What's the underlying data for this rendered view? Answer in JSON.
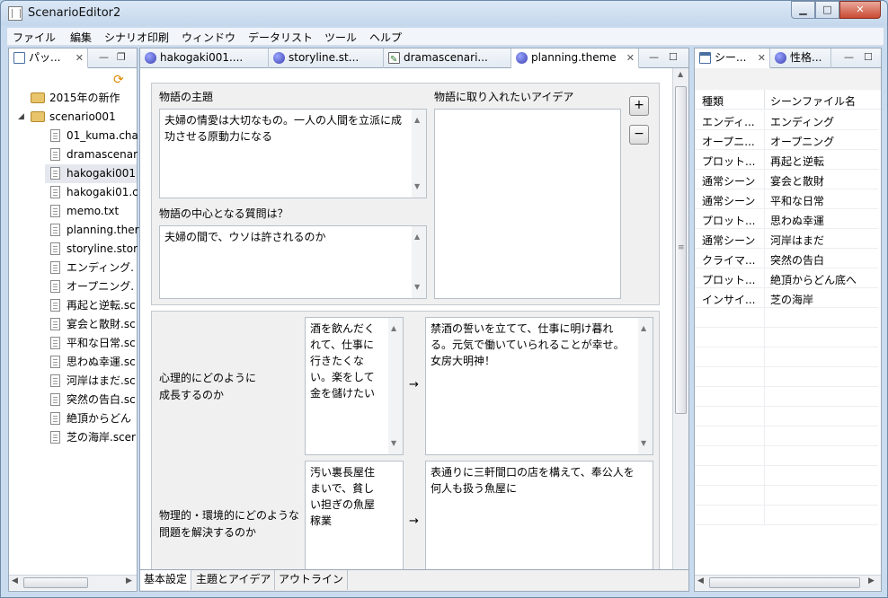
{
  "window": {
    "title": "ScenarioEditor2",
    "minimize": "▁",
    "maximize": "□",
    "close": "✕"
  },
  "menu": [
    "ファイル",
    "編集",
    "シナリオ印刷",
    "ウィンドウ",
    "データリスト",
    "ツール",
    "ヘルプ"
  ],
  "left_panel": {
    "tab_label": "パッ...",
    "tree": [
      {
        "label": "2015年の新作",
        "type": "folder",
        "level": 0
      },
      {
        "label": "scenario001",
        "type": "folder",
        "level": 0,
        "expanded": true
      },
      {
        "label": "01_kuma.cha",
        "type": "file",
        "level": 1
      },
      {
        "label": "dramascenar",
        "type": "file",
        "level": 1
      },
      {
        "label": "hakogaki001",
        "type": "file",
        "level": 1,
        "selected": true
      },
      {
        "label": "hakogaki01.c",
        "type": "file",
        "level": 1
      },
      {
        "label": "memo.txt",
        "type": "file",
        "level": 1
      },
      {
        "label": "planning.ther",
        "type": "file",
        "level": 1
      },
      {
        "label": "storyline.stor",
        "type": "file",
        "level": 1
      },
      {
        "label": "エンディング.",
        "type": "file",
        "level": 1
      },
      {
        "label": "オープニング.",
        "type": "file",
        "level": 1
      },
      {
        "label": "再起と逆転.sc",
        "type": "file",
        "level": 1
      },
      {
        "label": "宴会と散財.sc",
        "type": "file",
        "level": 1
      },
      {
        "label": "平和な日常.sc",
        "type": "file",
        "level": 1
      },
      {
        "label": "思わぬ幸運.sc",
        "type": "file",
        "level": 1
      },
      {
        "label": "河岸はまだ.sc",
        "type": "file",
        "level": 1
      },
      {
        "label": "突然の告白.sc",
        "type": "file",
        "level": 1
      },
      {
        "label": "絶頂からどん",
        "type": "file",
        "level": 1
      },
      {
        "label": "芝の海岸.scer",
        "type": "file",
        "level": 1
      }
    ]
  },
  "editor": {
    "tabs": [
      {
        "label": "hakogaki001....",
        "icon": "globe-icon"
      },
      {
        "label": "storyline.st...",
        "icon": "globe-icon"
      },
      {
        "label": "dramascenari...",
        "icon": "edit-doc-icon"
      },
      {
        "label": "planning.theme",
        "icon": "globe-icon",
        "active": true
      }
    ],
    "theme_label": "物語の主題",
    "theme_text": "夫婦の情愛は大切なもの。一人の人間を立派に成功させる原動力になる",
    "question_label": "物語の中心となる質問は？",
    "question_text": "夫婦の間で、ウソは許されるのか",
    "ideas_label": "物語に取り入れたいアイデア",
    "add_button": "+",
    "remove_button": "−",
    "arrow": "→",
    "growth_rows": [
      {
        "label_line1": "心理的にどのように",
        "label_line2": "成長するのか",
        "before": "酒を飲んだくれて、仕事に行きたくない。楽をして金を儲けたい",
        "after": "禁酒の誓いを立てて、仕事に明け暮れる。元気で働いていられることが幸せ。女房大明神！"
      },
      {
        "label_line1": "物理的・環境的にどのような",
        "label_line2": "問題を解決するのか",
        "before": "汚い裏長屋住まいで、貧しい担ぎの魚屋稼業",
        "after": "表通りに三軒間口の店を構えて、奉公人を何人も扱う魚屋に"
      }
    ],
    "bottom_tabs": [
      {
        "label": "基本設定",
        "active": true
      },
      {
        "label": "主題とアイデア"
      },
      {
        "label": "アウトライン"
      }
    ]
  },
  "right_panel": {
    "tabs": [
      {
        "label": "シー...",
        "active": true
      },
      {
        "label": "性格..."
      }
    ],
    "columns": [
      "種類",
      "シーンファイル名"
    ],
    "rows": [
      [
        "エンディ...",
        "エンディング"
      ],
      [
        "オープニ...",
        "オープニング"
      ],
      [
        "プロット...",
        "再起と逆転"
      ],
      [
        "通常シーン",
        "宴会と散財"
      ],
      [
        "通常シーン",
        "平和な日常"
      ],
      [
        "プロット...",
        "思わぬ幸運"
      ],
      [
        "通常シーン",
        "河岸はまだ"
      ],
      [
        "クライマ...",
        "突然の告白"
      ],
      [
        "プロット...",
        "絶頂からどん底へ"
      ],
      [
        "インサイ...",
        "芝の海岸"
      ]
    ]
  }
}
